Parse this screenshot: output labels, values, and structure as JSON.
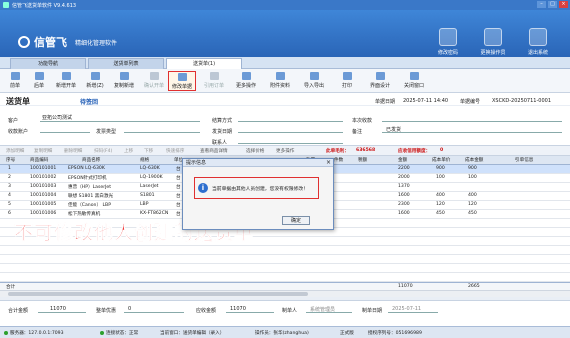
{
  "window": {
    "title": "信管飞送货单软件 V9.4.613"
  },
  "brand": {
    "name": "信管飞",
    "slogan": "精细化管理软件"
  },
  "top_buttons": [
    {
      "label": "修改密码",
      "icon": "key-icon"
    },
    {
      "label": "更换操作员",
      "icon": "users-icon"
    },
    {
      "label": "退出系统",
      "icon": "power-icon"
    }
  ],
  "tabs": [
    {
      "label": "功能导航"
    },
    {
      "label": "送货单列表"
    },
    {
      "label": "送货单(1)"
    }
  ],
  "toolbar": [
    {
      "label": "前单",
      "state": "normal"
    },
    {
      "label": "后单",
      "state": "normal"
    },
    {
      "label": "新增开单",
      "state": "normal"
    },
    {
      "label": "新增(Z)",
      "state": "normal"
    },
    {
      "label": "复制新增",
      "state": "normal"
    },
    {
      "label": "确认开单",
      "state": "disabled"
    },
    {
      "label": "修改单据",
      "state": "highlight"
    },
    {
      "label": "引用订单",
      "state": "disabled"
    },
    {
      "label": "更多操作",
      "state": "normal"
    },
    {
      "label": "附件资料",
      "state": "normal"
    },
    {
      "label": "导入导出",
      "state": "normal"
    },
    {
      "label": "打印",
      "state": "normal"
    },
    {
      "label": "界面设计",
      "state": "normal"
    },
    {
      "label": "关闭窗口",
      "state": "normal"
    }
  ],
  "doc": {
    "title": "送货单",
    "status": "待签回",
    "date_label": "单据日期",
    "date_value": "2025-07-11 14:40",
    "no_label": "单据编号",
    "no_value": "XSCKD-20250711-0001"
  },
  "fields": {
    "customer_label": "客户",
    "customer_value": "亚拓公司测试",
    "settle_label": "结算方式",
    "collect_label": "本次收款",
    "payee_label": "收款账户",
    "invoice_label": "发票类型",
    "ship_date_label": "发货日期",
    "contact_label": "联系人",
    "note_label": "备注",
    "note_value": "已发货"
  },
  "subbar": {
    "add_row": "添加明细",
    "copy_row": "复制明细",
    "delete_row": "删除明细",
    "scan": "扫码(F4)",
    "up": "上移",
    "down": "下移",
    "quick_sort": "快速排序",
    "product_detail": "查看商品详情",
    "choose_price": "选择价格",
    "more": "更多操作",
    "profit_label": "此单毛利：",
    "profit_value": "636568",
    "credit_label": "应收信用额度：",
    "credit_value": "0"
  },
  "grid": {
    "headers": [
      "序号",
      "商品编码",
      "商品名称",
      "规格",
      "单位",
      "数量",
      "件数",
      "税额",
      "金额",
      "成本单价",
      "成本金额",
      "引单信息"
    ],
    "rows": [
      [
        "1",
        "100101001",
        "EPSON LQ-630K",
        "LQ-630K",
        "台",
        "20",
        "",
        "",
        "2200",
        "900",
        "900",
        ""
      ],
      [
        "2",
        "100101002",
        "EPSON针式打印机",
        "LQ-1900K",
        "台",
        "",
        "",
        "",
        "2000",
        "100",
        "100",
        ""
      ],
      [
        "3",
        "100101003",
        "惠普（HP）LaserJet",
        "LaserJet",
        "台",
        "",
        "",
        "",
        "1370",
        "",
        "",
        ""
      ],
      [
        "4",
        "100101004",
        "联想 S1801 黑白激光",
        "S1801",
        "台",
        "",
        "",
        "",
        "1600",
        "400",
        "400",
        ""
      ],
      [
        "5",
        "100101005",
        "佳能（Canon） LBP",
        "LBP",
        "台",
        "",
        "",
        "",
        "2300",
        "120",
        "120",
        ""
      ],
      [
        "6",
        "100101006",
        "松下热敏传真机",
        "KX-FT862CN",
        "台",
        "",
        "",
        "",
        "1600",
        "450",
        "450",
        ""
      ],
      [
        "",
        "",
        "",
        "",
        "",
        "",
        "",
        "",
        "",
        "",
        "",
        ""
      ],
      [
        "",
        "",
        "",
        "",
        "",
        "",
        "",
        "",
        "",
        "",
        "",
        ""
      ],
      [
        "",
        "",
        "",
        "",
        "",
        "",
        "",
        "",
        "",
        "",
        "",
        ""
      ],
      [
        "",
        "",
        "",
        "",
        "",
        "",
        "",
        "",
        "",
        "",
        "",
        ""
      ],
      [
        "",
        "",
        "",
        "",
        "",
        "",
        "",
        "",
        "",
        "",
        "",
        ""
      ],
      [
        "",
        "",
        "",
        "",
        "",
        "",
        "",
        "",
        "",
        "",
        "",
        ""
      ],
      [
        "",
        "",
        "",
        "",
        "",
        "",
        "",
        "",
        "",
        "",
        "",
        ""
      ]
    ],
    "total_row": {
      "label": "合计",
      "amount": "11070",
      "cost": "2665"
    }
  },
  "dialog": {
    "title": "提示信息",
    "message": "当前单据由其他人员创建，您没有权限修改！",
    "ok": "确定"
  },
  "caption": "不可修改他人创建的送货单",
  "footer": {
    "total_label": "合计金额",
    "total_value": "11070",
    "discount_label": "整单优惠",
    "discount_value": "0",
    "receivable_label": "应收金额",
    "receivable_value": "11070",
    "creator_label": "制单人",
    "creator_value": "系统管理员",
    "create_date_label": "制单日期",
    "create_date_value": "2025-07-11"
  },
  "status": {
    "server": "服务器：127.0.0.1:7093",
    "connection": "连接状态：正常",
    "module": "当前窗口：送货单编辑（录入）",
    "operator": "操作员：张华(zhanghua)",
    "edition": "正式版",
    "auth": "授权序列号：051696989"
  }
}
